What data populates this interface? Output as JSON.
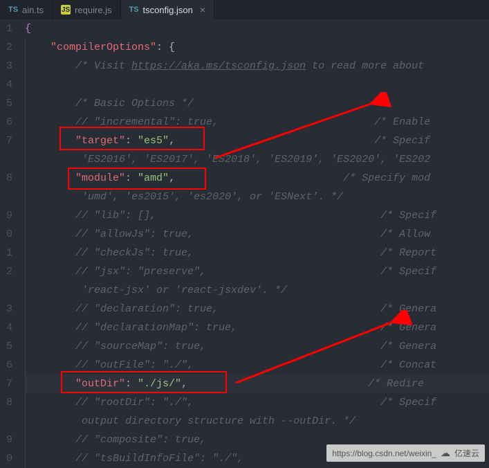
{
  "tabs": [
    {
      "icon": "ts",
      "label": "ain.ts",
      "active": false
    },
    {
      "icon": "js",
      "label": "require.js",
      "active": false
    },
    {
      "icon": "ts",
      "label": "tsconfig.json",
      "active": true
    }
  ],
  "gutter": [
    "1",
    "2",
    "3",
    "4",
    "5",
    "6",
    "7",
    "8",
    "9",
    "0",
    "1",
    "2",
    "3",
    "4",
    "5",
    "6",
    "7",
    "8",
    "9",
    "0"
  ],
  "code": {
    "l1_brace": "{",
    "l2_indent": "    ",
    "l2_key": "\"compilerOptions\"",
    "l2_after": ": {",
    "l3": "        /* Visit ",
    "l3_link": "https://aka.ms/tsconfig.json",
    "l3_after": " to read more about ",
    "l4": "",
    "l5": "        /* Basic Options */",
    "l6": "        // \"incremental\": true,                         /* Enable",
    "l7_indent": "        ",
    "l7_key": "\"target\"",
    "l7_colon": ": ",
    "l7_val": "\"es5\"",
    "l7_comma": ",",
    "l7_comment": "                                /* Specif",
    "l7b": "         'ES2016', 'ES2017', 'ES2018', 'ES2019', 'ES2020', 'ES202",
    "l8_indent": "        ",
    "l8_key": "\"module\"",
    "l8_colon": ": ",
    "l8_val": "\"amd\"",
    "l8_comma": ",",
    "l8_comment": "                           /* Specify mod",
    "l8b": "         'umd', 'es2015', 'es2020', or 'ESNext'. */",
    "l9": "        // \"lib\": [],                                    /* Specif",
    "l10": "        // \"allowJs\": true,                              /* Allow ",
    "l11": "        // \"checkJs\": true,                              /* Report",
    "l12": "        // \"jsx\": \"preserve\",                            /* Specif",
    "l12b": "         'react-jsx' or 'react-jsxdev'. */",
    "l13": "        // \"declaration\": true,                          /* Genera",
    "l14": "        // \"declarationMap\": true,                       /* Genera",
    "l15": "        // \"sourceMap\": true,                            /* Genera",
    "l16": "        // \"outFile\": \"./\",                              /* Concat",
    "l17_indent": "        ",
    "l17_key": "\"outDir\"",
    "l17_colon": ": ",
    "l17_val": "\"./js/\"",
    "l17_comma": ",",
    "l17_comment": "                             /* Redire",
    "l18": "        // \"rootDir\": \"./\",                              /* Specif",
    "l18b": "         output directory structure with --outDir. */",
    "l19": "        // \"composite\": true,                            ",
    "l20": "        // \"tsBuildInfoFile\": \"./\",                      "
  },
  "watermark": {
    "url": "https://blog.csdn.net/weixin_",
    "brand": "亿速云"
  }
}
